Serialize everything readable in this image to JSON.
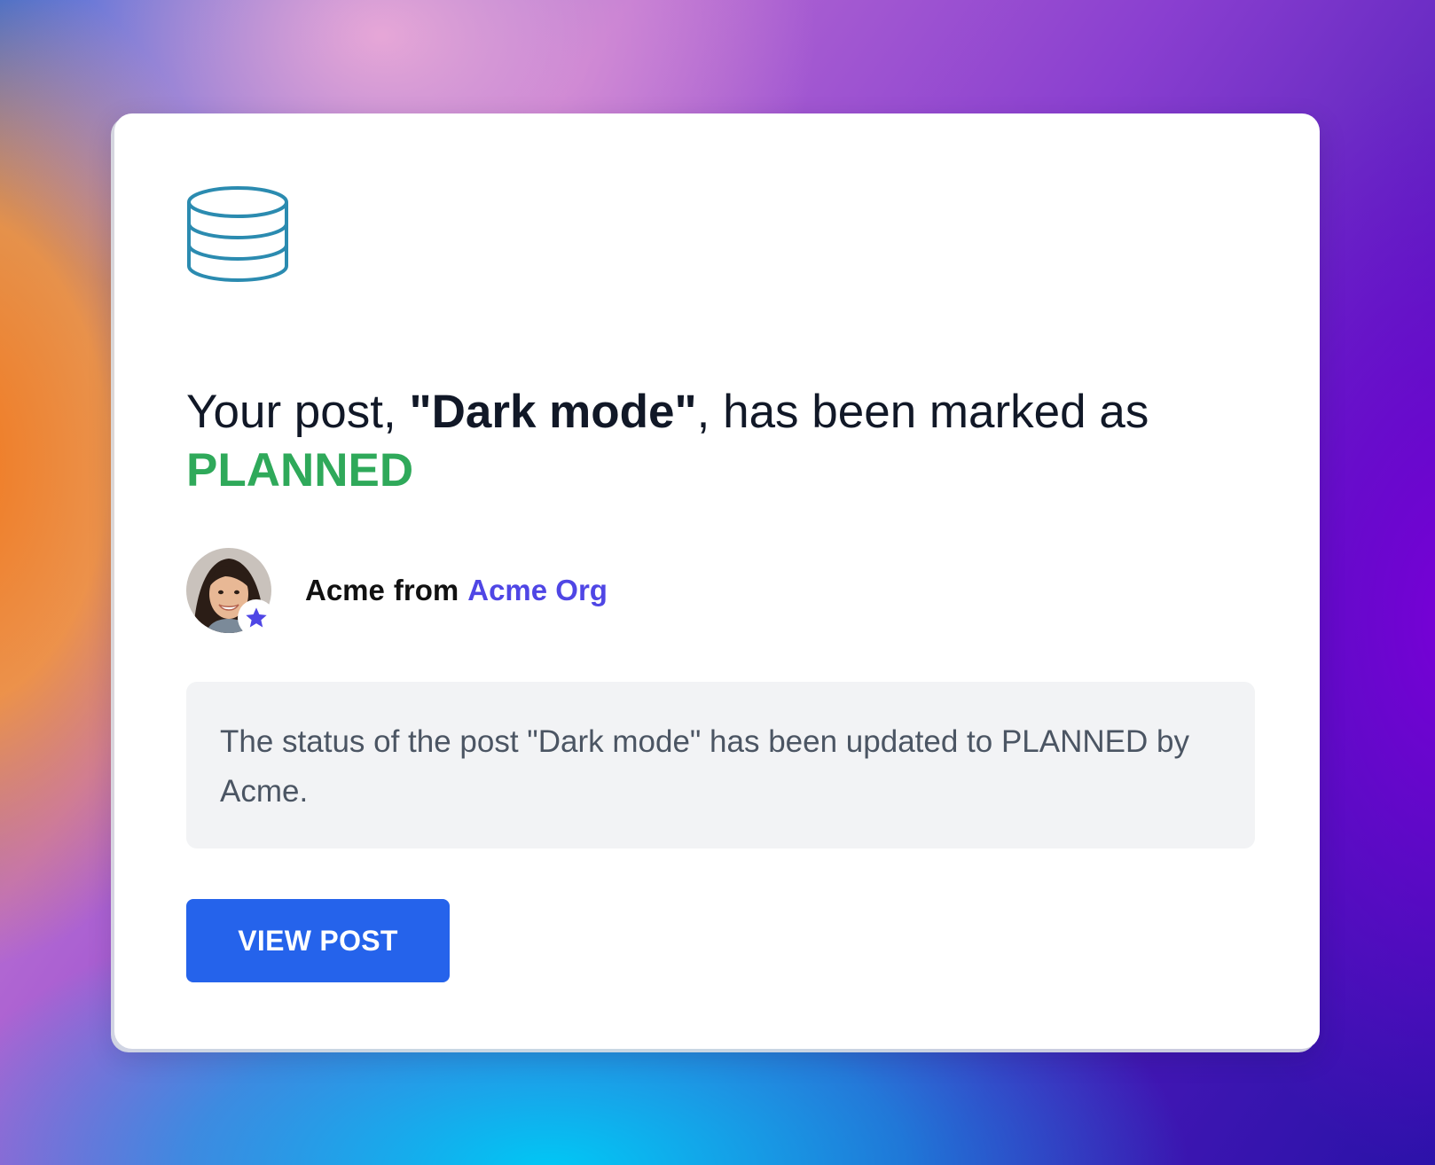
{
  "notification": {
    "icon": "database-icon",
    "headline": {
      "prefix": "Your post, ",
      "post_title": "\"Dark mode\"",
      "suffix": ", has been marked as",
      "status": "PLANNED",
      "status_color": "#2fa95a"
    },
    "author": {
      "name": "Acme",
      "connector": "from",
      "org": "Acme Org",
      "org_color": "#4f46e5",
      "badge_icon": "star-icon"
    },
    "message": "The status of the post \"Dark mode\" has been updated to PLANNED by Acme.",
    "button": {
      "label": "VIEW POST",
      "color": "#2563eb"
    }
  }
}
